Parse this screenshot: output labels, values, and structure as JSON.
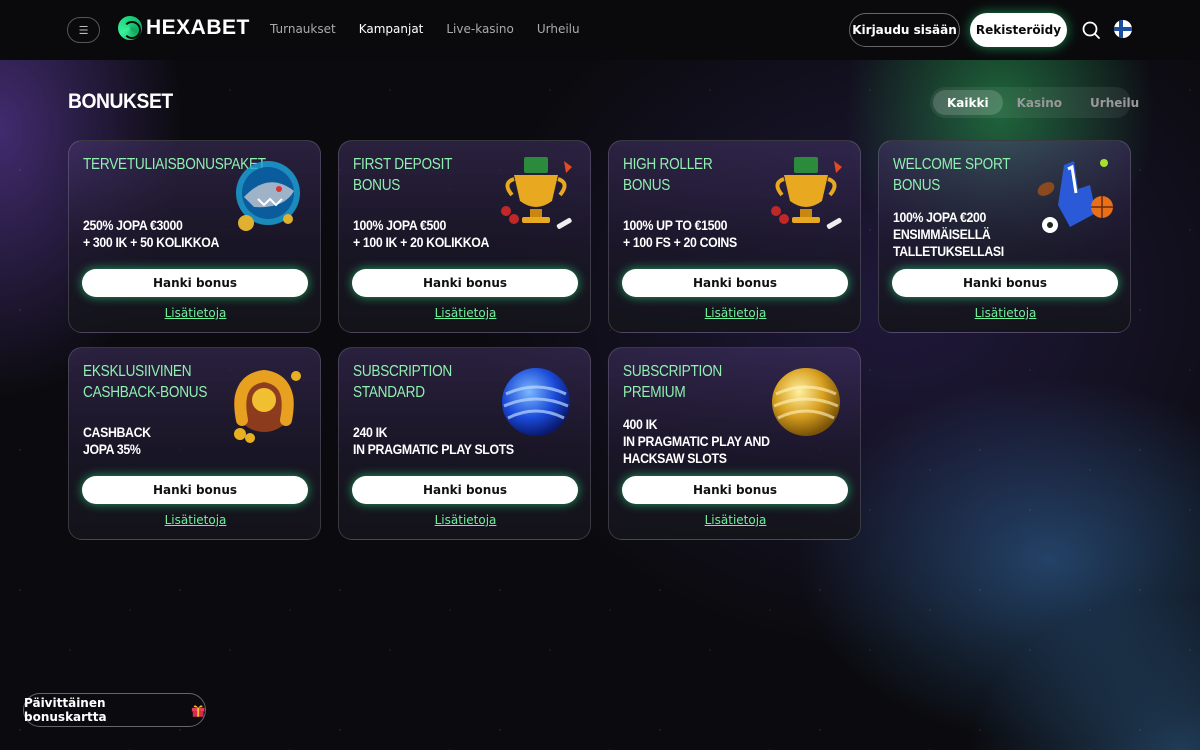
{
  "header": {
    "logo_text": "HEXABET",
    "nav": [
      "Turnaukset",
      "Kampanjat",
      "Live-kasino",
      "Urheilu"
    ],
    "nav_active_index": 1,
    "login_label": "Kirjaudu sisään",
    "register_label": "Rekisteröidy"
  },
  "page": {
    "title": "BONUKSET",
    "filters": [
      "Kaikki",
      "Kasino",
      "Urheilu"
    ],
    "active_filter_index": 0
  },
  "cards": [
    {
      "title": "TERVETULIAISBONUSPAKET",
      "desc_line1": "250% JOPA €3000",
      "desc_line2": "+ 300 IK + 50 KOLIKKOA",
      "desc_line3": "",
      "button": "Hanki bonus",
      "link": "Lisätietoja",
      "image": "shark-icon"
    },
    {
      "title": "FIRST DEPOSIT BONUS",
      "desc_line1": "100% JOPA €500",
      "desc_line2": "+ 100 IK + 20 KOLIKKOA",
      "desc_line3": "",
      "button": "Hanki bonus",
      "link": "Lisätietoja",
      "image": "trophy-icon"
    },
    {
      "title": "HIGH ROLLER BONUS",
      "desc_line1": "100% UP TO €1500",
      "desc_line2": "+ 100 FS + 20 COINS",
      "desc_line3": "",
      "button": "Hanki bonus",
      "link": "Lisätietoja",
      "image": "trophy-icon"
    },
    {
      "title": "WELCOME SPORT BONUS",
      "desc_line1": "100% JOPA €200",
      "desc_line2": "ENSIMMÄISELLÄ",
      "desc_line3": "TALLETUKSELLASI",
      "button": "Hanki bonus",
      "link": "Lisätietoja",
      "image": "foam-finger-icon"
    },
    {
      "title": "EKSKLUSIIVINEN CASHBACK-BONUS",
      "desc_line1": "CASHBACK",
      "desc_line2": "JOPA 35%",
      "desc_line3": "",
      "button": "Hanki bonus",
      "link": "Lisätietoja",
      "image": "horseshoe-icon"
    },
    {
      "title": "SUBSCRIPTION STANDARD",
      "desc_line1": "240 IK",
      "desc_line2": "IN PRAGMATIC PLAY SLOTS",
      "desc_line3": "",
      "button": "Hanki bonus",
      "link": "Lisätietoja",
      "image": "blue-sphere-icon"
    },
    {
      "title": "SUBSCRIPTION PREMIUM",
      "desc_line1": "400 IK",
      "desc_line2": "IN PRAGMATIC PLAY AND",
      "desc_line3": "HACKSAW SLOTS",
      "button": "Hanki bonus",
      "link": "Lisätietoja",
      "image": "gold-sphere-icon"
    }
  ],
  "footer": {
    "daily_label": "Päivittäinen bonuskartta"
  },
  "colors": {
    "accent_green": "#6ff09d",
    "title_green": "#8ff0b0",
    "background": "#0b0b0f"
  }
}
